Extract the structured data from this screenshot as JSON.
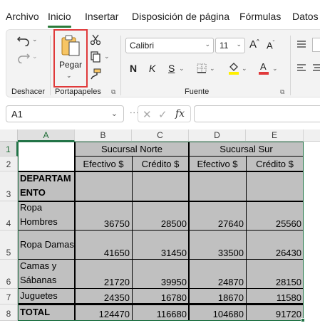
{
  "tabs": [
    {
      "label": "Archivo"
    },
    {
      "label": "Inicio"
    },
    {
      "label": "Insertar"
    },
    {
      "label": "Disposición de página"
    },
    {
      "label": "Fórmulas"
    },
    {
      "label": "Datos"
    }
  ],
  "ribbon": {
    "groups": {
      "undo": "Deshacer",
      "clipboard": "Portapapeles",
      "font": "Fuente"
    },
    "paste_label": "Pegar",
    "font_name": "Calibri",
    "font_size": "11",
    "bold": "N",
    "italic": "K",
    "underline": "S",
    "colors": {
      "highlight": "#ffef00",
      "font": "#e0393a",
      "accent": "#217346"
    }
  },
  "formula_bar": {
    "name_box": "A1",
    "fx": "fx",
    "formula": ""
  },
  "grid": {
    "columns": [
      "A",
      "B",
      "C",
      "D",
      "E"
    ],
    "rows": [
      "1",
      "2",
      "3",
      "4",
      "5",
      "6",
      "7",
      "8"
    ],
    "header_row1": {
      "norte": "Sucursal Norte",
      "sur": "Sucursal Sur"
    },
    "header_row2": [
      "Efectivo $",
      "Crédito $",
      "Efectivo $",
      "Crédito $"
    ],
    "row3_label": "DEPARTAM ENTO",
    "data": [
      {
        "label": "Ropa Hombres",
        "values": [
          "36750",
          "28500",
          "27640",
          "25560"
        ]
      },
      {
        "label": "Ropa Damas",
        "values": [
          "41650",
          "31450",
          "33500",
          "26430"
        ]
      },
      {
        "label": "Camas y Sábanas",
        "values": [
          "21720",
          "39950",
          "24870",
          "28150"
        ]
      },
      {
        "label": "Juguetes",
        "values": [
          "24350",
          "16780",
          "18670",
          "11580"
        ]
      }
    ],
    "total": {
      "label": "TOTAL",
      "values": [
        "124470",
        "116680",
        "104680",
        "91720"
      ]
    }
  }
}
